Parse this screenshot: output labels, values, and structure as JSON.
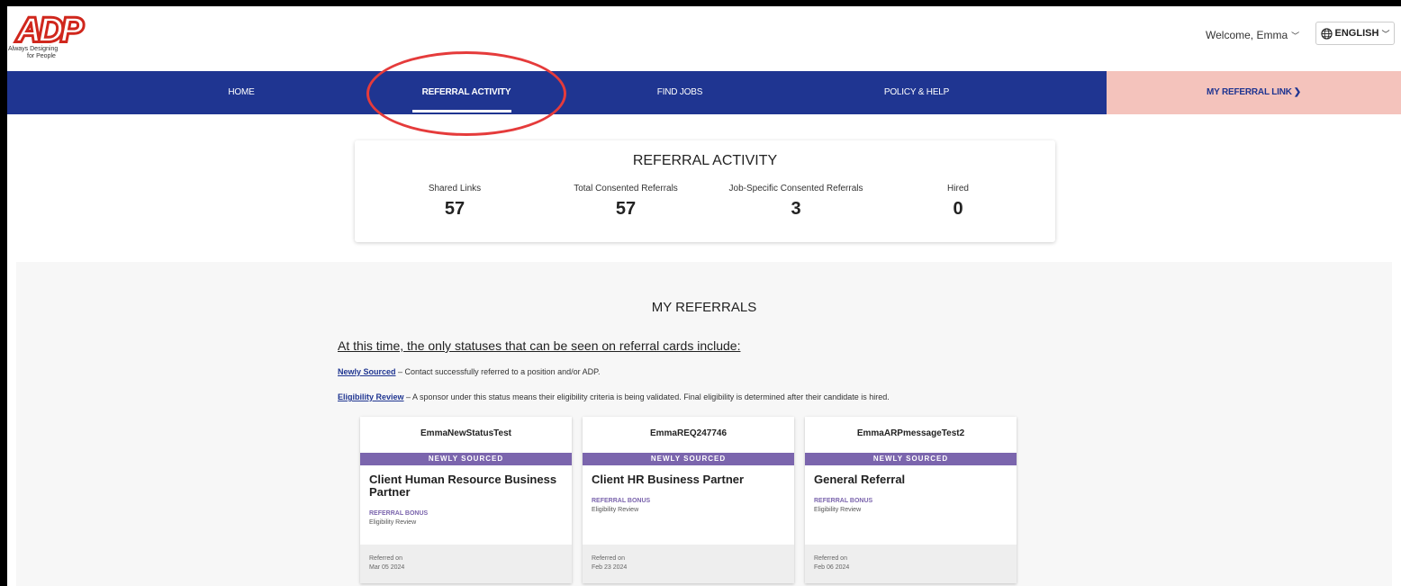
{
  "brand": {
    "logo_text": "ADP",
    "tagline_line1": "Always Designing",
    "tagline_line2": "for People",
    "colors": {
      "logo_red": "#d0271d",
      "nav_blue": "#1f3591",
      "link_bg": "#f4c3bc",
      "badge_purple": "#7b65ad",
      "highlight_circle": "#e53b3b"
    }
  },
  "header": {
    "welcome": "Welcome, Emma",
    "language": "ENGLISH"
  },
  "nav": {
    "items": [
      {
        "label": "HOME"
      },
      {
        "label": "REFERRAL ACTIVITY",
        "active": true
      },
      {
        "label": "FIND JOBS"
      },
      {
        "label": "POLICY & HELP"
      }
    ],
    "my_link": "MY REFERRAL LINK"
  },
  "activity": {
    "title": "REFERRAL ACTIVITY",
    "stats": [
      {
        "label": "Shared Links",
        "value": "57"
      },
      {
        "label": "Total Consented Referrals",
        "value": "57"
      },
      {
        "label": "Job-Specific Consented Referrals",
        "value": "3"
      },
      {
        "label": "Hired",
        "value": "0"
      }
    ]
  },
  "referrals": {
    "title": "MY REFERRALS",
    "intro": "At this time, the only statuses that can be seen on referral cards include:",
    "statuses": [
      {
        "term": "Newly Sourced",
        "desc": " – Contact successfully referred to a position and/or ADP."
      },
      {
        "term": "Eligibility Review",
        "desc": " – A sponsor under this status means their eligibility criteria is being validated. Final eligibility is determined after their candidate is hired."
      }
    ],
    "cards": [
      {
        "name": "EmmaNewStatusTest",
        "status": "NEWLY SOURCED",
        "job": "Client Human Resource Business Partner",
        "bonus": "REFERRAL BONUS",
        "eligibility": "Eligibility Review",
        "referred_label": "Referred on",
        "date": "Mar 05 2024"
      },
      {
        "name": "EmmaREQ247746",
        "status": "NEWLY SOURCED",
        "job": "Client HR Business Partner",
        "bonus": "REFERRAL BONUS",
        "eligibility": "Eligibility Review",
        "referred_label": "Referred on",
        "date": "Feb 23 2024"
      },
      {
        "name": "EmmaARPmessageTest2",
        "status": "NEWLY SOURCED",
        "job": "General Referral",
        "bonus": "REFERRAL BONUS",
        "eligibility": "Eligibility Review",
        "referred_label": "Referred on",
        "date": "Feb 06 2024"
      }
    ]
  }
}
